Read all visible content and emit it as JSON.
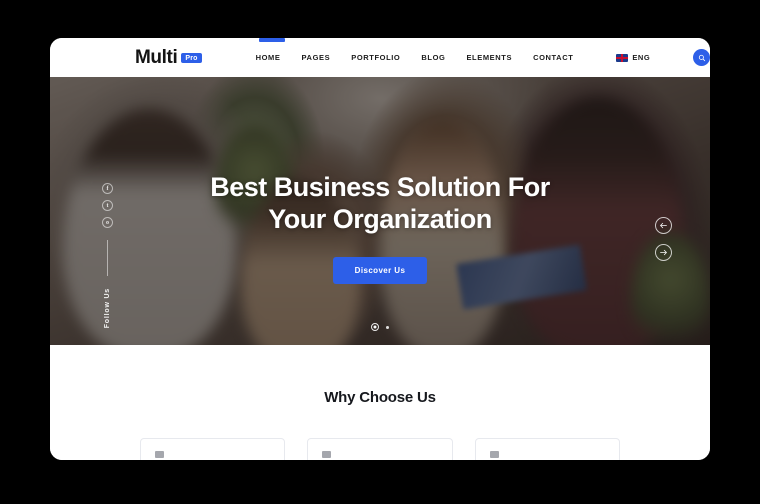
{
  "browser": {
    "tab_indicator_color": "#2d5fe8"
  },
  "theme": {
    "accent": "#2d5fe8",
    "text_dark": "#16181d",
    "page_bg": "#ffffff",
    "backdrop": "#000000"
  },
  "header": {
    "logo": {
      "text": "Multi",
      "badge": "Pro"
    },
    "nav": [
      {
        "label": "HOME",
        "active": true
      },
      {
        "label": "PAGES",
        "active": false
      },
      {
        "label": "PORTFOLIO",
        "active": false
      },
      {
        "label": "BLOG",
        "active": false
      },
      {
        "label": "ELEMENTS",
        "active": false
      },
      {
        "label": "CONTACT",
        "active": false
      }
    ],
    "language": {
      "icon": "uk-flag-icon",
      "label": "ENG"
    },
    "search": {
      "icon": "search-icon"
    }
  },
  "hero": {
    "title_line1": "Best Business Solution For",
    "title_line2": "Your Organization",
    "cta_label": "Discover Us",
    "social": {
      "label": "Follow Us",
      "items": [
        {
          "icon": "facebook-icon",
          "glyph": "f"
        },
        {
          "icon": "twitter-icon",
          "glyph": "t"
        },
        {
          "icon": "instagram-icon",
          "glyph": "o"
        }
      ]
    },
    "controls": {
      "prev_icon": "arrow-left-icon",
      "next_icon": "arrow-right-icon"
    },
    "slides": [
      {
        "index": 1,
        "active": true
      },
      {
        "index": 2,
        "active": false
      }
    ]
  },
  "why_choose_us": {
    "title": "Why Choose Us",
    "cards": [
      {
        "icon": "feature-icon-1"
      },
      {
        "icon": "feature-icon-2"
      },
      {
        "icon": "feature-icon-3"
      }
    ]
  }
}
